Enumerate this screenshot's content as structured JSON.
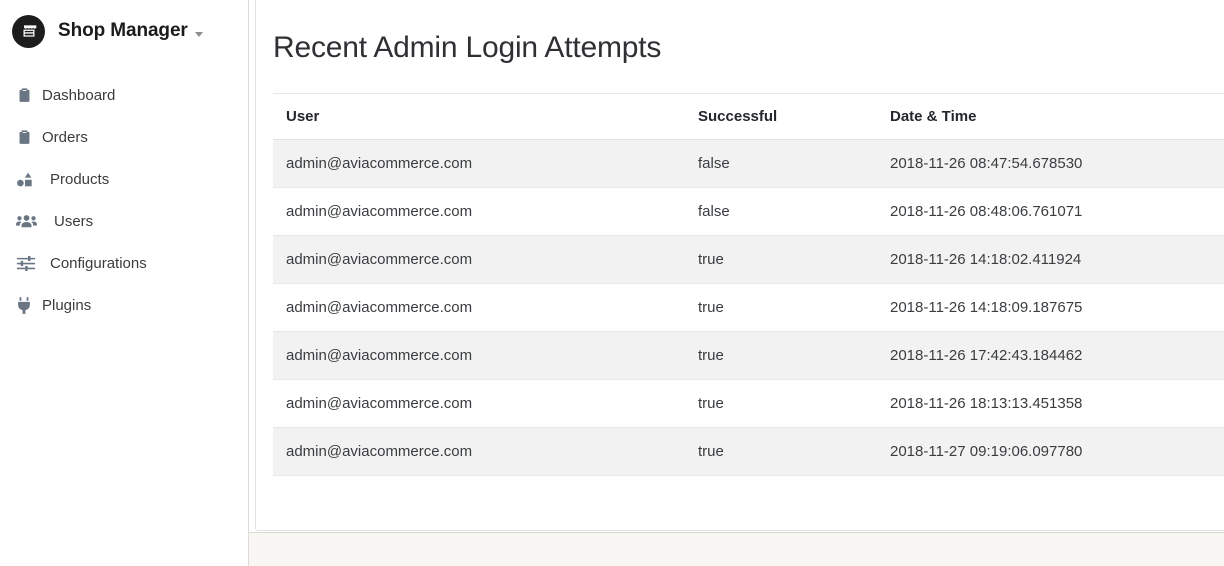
{
  "sidebar": {
    "brand": {
      "title": "Shop Manager",
      "logo_icon": "shop-store-icon",
      "caret_icon": "chevron-down-icon"
    },
    "items": [
      {
        "label": "Dashboard",
        "icon": "clipboard-list-icon"
      },
      {
        "label": "Orders",
        "icon": "clipboard-list-icon"
      },
      {
        "label": "Products",
        "icon": "shapes-icon"
      },
      {
        "label": "Users",
        "icon": "users-group-icon"
      },
      {
        "label": "Configurations",
        "icon": "sliders-icon"
      },
      {
        "label": "Plugins",
        "icon": "plug-icon"
      }
    ]
  },
  "main": {
    "page_title": "Recent Admin Login Attempts",
    "table": {
      "columns": [
        "User",
        "Successful",
        "Date & Time"
      ],
      "rows": [
        {
          "user": "admin@aviacommerce.com",
          "successful": "false",
          "datetime": "2018-11-26 08:47:54.678530"
        },
        {
          "user": "admin@aviacommerce.com",
          "successful": "false",
          "datetime": "2018-11-26 08:48:06.761071"
        },
        {
          "user": "admin@aviacommerce.com",
          "successful": "true",
          "datetime": "2018-11-26 14:18:02.411924"
        },
        {
          "user": "admin@aviacommerce.com",
          "successful": "true",
          "datetime": "2018-11-26 14:18:09.187675"
        },
        {
          "user": "admin@aviacommerce.com",
          "successful": "true",
          "datetime": "2018-11-26 17:42:43.184462"
        },
        {
          "user": "admin@aviacommerce.com",
          "successful": "true",
          "datetime": "2018-11-26 18:13:13.451358"
        },
        {
          "user": "admin@aviacommerce.com",
          "successful": "true",
          "datetime": "2018-11-27 09:19:06.097780"
        }
      ]
    }
  },
  "colors": {
    "logo_background": "#1d1d1d",
    "row_stripe": "#f2f2f2",
    "footer_background": "#f8f7f3",
    "sidebar_border": "#dcdcdc",
    "icon_gray": "#6b7684"
  }
}
